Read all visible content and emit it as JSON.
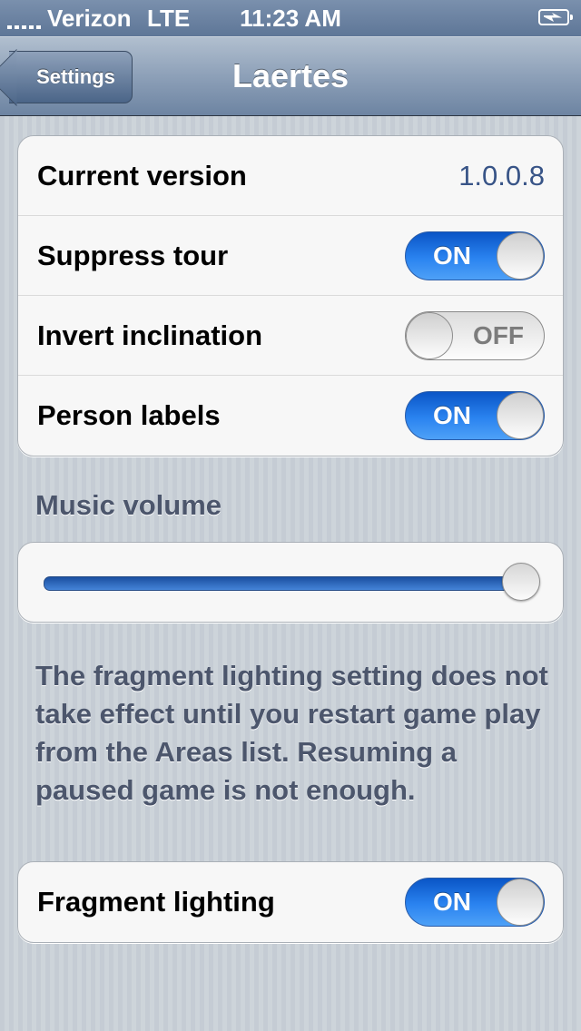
{
  "status_bar": {
    "carrier": "Verizon",
    "network": "LTE",
    "time": "11:23 AM",
    "battery_icon": "battery-charging-icon",
    "signal_icon": "signal-bars-icon"
  },
  "nav_bar": {
    "back_label": "Settings",
    "title": "Laertes"
  },
  "general": {
    "version_label": "Current version",
    "version_value": "1.0.0.8",
    "rows": [
      {
        "label": "Suppress tour",
        "state": "ON"
      },
      {
        "label": "Invert inclination",
        "state": "OFF"
      },
      {
        "label": "Person labels",
        "state": "ON"
      }
    ]
  },
  "music": {
    "header": "Music volume",
    "volume_fraction": 1.0
  },
  "fragment": {
    "footer": "The fragment lighting setting does not take effect until you restart game play from the Areas list. Resuming a paused game is not enough.",
    "label": "Fragment lighting",
    "state": "ON"
  },
  "colors": {
    "toggle_on": "#2a83f0",
    "nav_bar": "#6d84a2",
    "value_text": "#385487"
  }
}
